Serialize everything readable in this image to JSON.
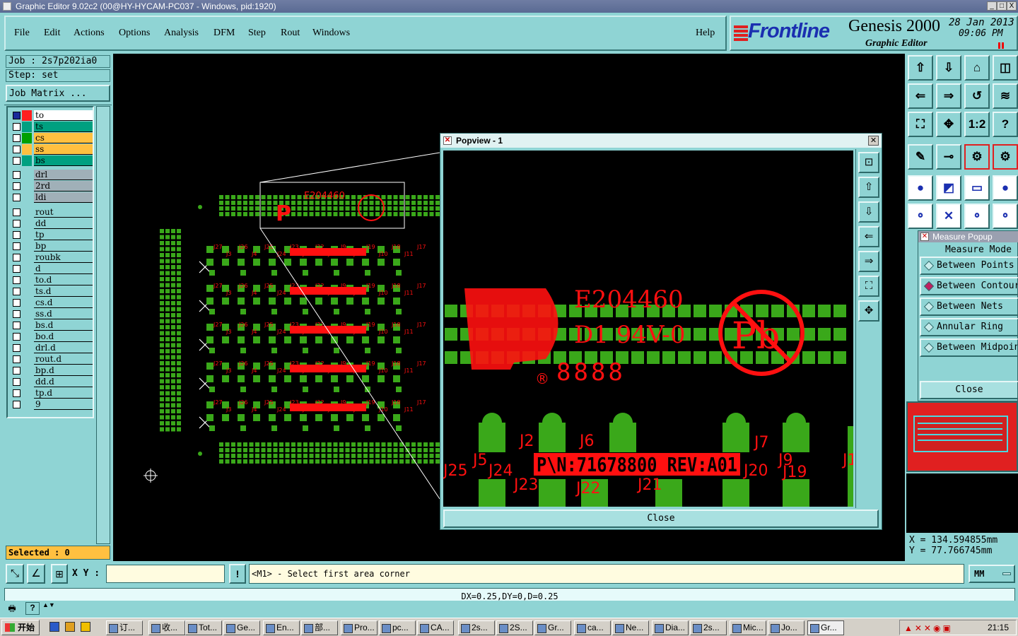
{
  "window": {
    "title": "Graphic Editor 9.02c2 (00@HY-HYCAM-PC037 - Windows, pid:1920)",
    "btn_min": "_",
    "btn_max": "□",
    "btn_close": "X"
  },
  "menu": [
    "File",
    "Edit",
    "Actions",
    "Options",
    "Analysis",
    "DFM",
    "Step",
    "Rout",
    "Windows"
  ],
  "help": "Help",
  "brand": {
    "logo": "Frontline",
    "product": "Genesis 2000",
    "subtitle": "Graphic Editor",
    "date": "28 Jan 2013",
    "time": "09:06 PM"
  },
  "job": {
    "job_label": "Job : 2s7p202ia0",
    "step_label": "Step: set",
    "matrix_button": "Job Matrix ..."
  },
  "layers": [
    {
      "name": "to",
      "color": "#ff2020",
      "bg": "#ffffff"
    },
    {
      "name": "ts",
      "color": "#00a080",
      "bg": "#00a080"
    },
    {
      "name": "cs",
      "color": "#00a000",
      "bg": "#ffc040"
    },
    {
      "name": "ss",
      "color": "#ffc040",
      "bg": "#ffc040"
    },
    {
      "name": "bs",
      "color": "#00a080",
      "bg": "#00a080"
    },
    {
      "name": "drl",
      "color": "#8fd4d4",
      "bg": "#a0b0b8"
    },
    {
      "name": "2rd",
      "color": "#8fd4d4",
      "bg": "#a0b0b8"
    },
    {
      "name": "ldi",
      "color": "#8fd4d4",
      "bg": "#a0b0b8"
    },
    {
      "name": "rout",
      "color": "#8fd4d4",
      "bg": "#8fd4d4"
    },
    {
      "name": "dd",
      "color": "#8fd4d4",
      "bg": "#8fd4d4"
    },
    {
      "name": "tp",
      "color": "#8fd4d4",
      "bg": "#8fd4d4"
    },
    {
      "name": "bp",
      "color": "#8fd4d4",
      "bg": "#8fd4d4"
    },
    {
      "name": "roubk",
      "color": "#8fd4d4",
      "bg": "#8fd4d4"
    },
    {
      "name": "d",
      "color": "#8fd4d4",
      "bg": "#8fd4d4"
    },
    {
      "name": "to.d",
      "color": "#8fd4d4",
      "bg": "#8fd4d4"
    },
    {
      "name": "ts.d",
      "color": "#8fd4d4",
      "bg": "#8fd4d4"
    },
    {
      "name": "cs.d",
      "color": "#8fd4d4",
      "bg": "#8fd4d4"
    },
    {
      "name": "ss.d",
      "color": "#8fd4d4",
      "bg": "#8fd4d4"
    },
    {
      "name": "bs.d",
      "color": "#8fd4d4",
      "bg": "#8fd4d4"
    },
    {
      "name": "bo.d",
      "color": "#8fd4d4",
      "bg": "#8fd4d4"
    },
    {
      "name": "drl.d",
      "color": "#8fd4d4",
      "bg": "#8fd4d4"
    },
    {
      "name": "rout.d",
      "color": "#8fd4d4",
      "bg": "#8fd4d4"
    },
    {
      "name": "bp.d",
      "color": "#8fd4d4",
      "bg": "#8fd4d4"
    },
    {
      "name": "dd.d",
      "color": "#8fd4d4",
      "bg": "#8fd4d4"
    },
    {
      "name": "tp.d",
      "color": "#8fd4d4",
      "bg": "#8fd4d4"
    },
    {
      "name": "9",
      "color": "#8fd4d4",
      "bg": "#8fd4d4"
    }
  ],
  "selected": "Selected : 0",
  "popview": {
    "title": "Popview - 1",
    "close": "Close"
  },
  "board_text": {
    "ul": "E204460",
    "rating": "D1 94V-0",
    "pb": "Pb",
    "pn": "P\\N:71678800 REV:A01",
    "date_code": "8888",
    "j": [
      "J5",
      "J24",
      "J2",
      "J6",
      "J23",
      "J22",
      "J21",
      "J7",
      "J9",
      "J20",
      "J19",
      "J1",
      "J25"
    ],
    "small_j": [
      "J27",
      "J3",
      "J26",
      "J4",
      "J25",
      "J24",
      "J23",
      "J2",
      "J22",
      "J8",
      "J9",
      "J20",
      "J19",
      "J10",
      "J18",
      "J11",
      "J17"
    ]
  },
  "measure": {
    "title": "Measure Popup",
    "mode_label": "Measure Mode",
    "options": [
      "Between Points",
      "Between Contours",
      "Between Nets",
      "Annular Ring",
      "Between Midpoints"
    ],
    "close": "Close"
  },
  "coords": {
    "x": "X = 134.594855mm",
    "y": "Y =  77.766745mm"
  },
  "cmd": {
    "xy_label": "X Y :",
    "xy_value": "",
    "prompt": "<M1> - Select first area corner",
    "units": "MM"
  },
  "status": "DX=0.25,DY=0,D=0.25",
  "taskbar": {
    "start": "开始",
    "clock": "21:15",
    "tasks": [
      "订...",
      "收...",
      "Tot...",
      "Ge...",
      "En...",
      "部...",
      "Pro...",
      "pc...",
      "CA...",
      "2s...",
      "2S...",
      "Gr...",
      "ca...",
      "Ne...",
      "Dia...",
      "2s...",
      "Mic...",
      "Jo...",
      "Gr..."
    ]
  }
}
